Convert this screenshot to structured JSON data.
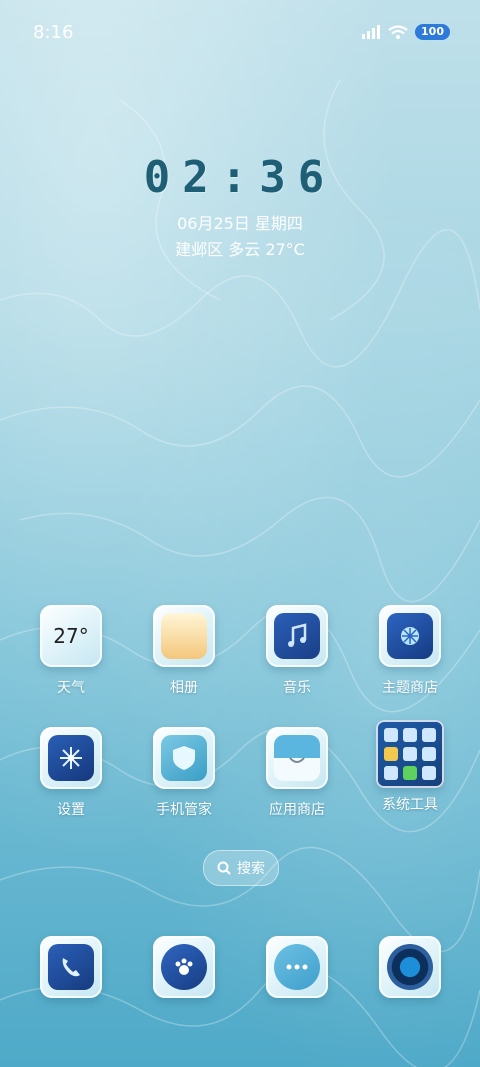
{
  "status_bar": {
    "time": "8:16",
    "battery": "100"
  },
  "lockclock": {
    "time": "02:36",
    "date": "06月25日 星期四",
    "weather": "建邺区 多云 27°C"
  },
  "apps": [
    {
      "label": "天气",
      "icon": "weather-icon",
      "badge": "27°"
    },
    {
      "label": "相册",
      "icon": "gallery-icon"
    },
    {
      "label": "音乐",
      "icon": "music-icon"
    },
    {
      "label": "主题商店",
      "icon": "theme-store-icon"
    },
    {
      "label": "设置",
      "icon": "settings-icon"
    },
    {
      "label": "手机管家",
      "icon": "phone-manager-icon"
    },
    {
      "label": "应用商店",
      "icon": "app-store-icon"
    },
    {
      "label": "系统工具",
      "icon": "system-tools-folder-icon"
    }
  ],
  "search": {
    "label": "搜索"
  },
  "dock": [
    {
      "icon": "phone-icon"
    },
    {
      "icon": "contacts-paw-icon"
    },
    {
      "icon": "messages-icon"
    },
    {
      "icon": "camera-icon"
    }
  ]
}
